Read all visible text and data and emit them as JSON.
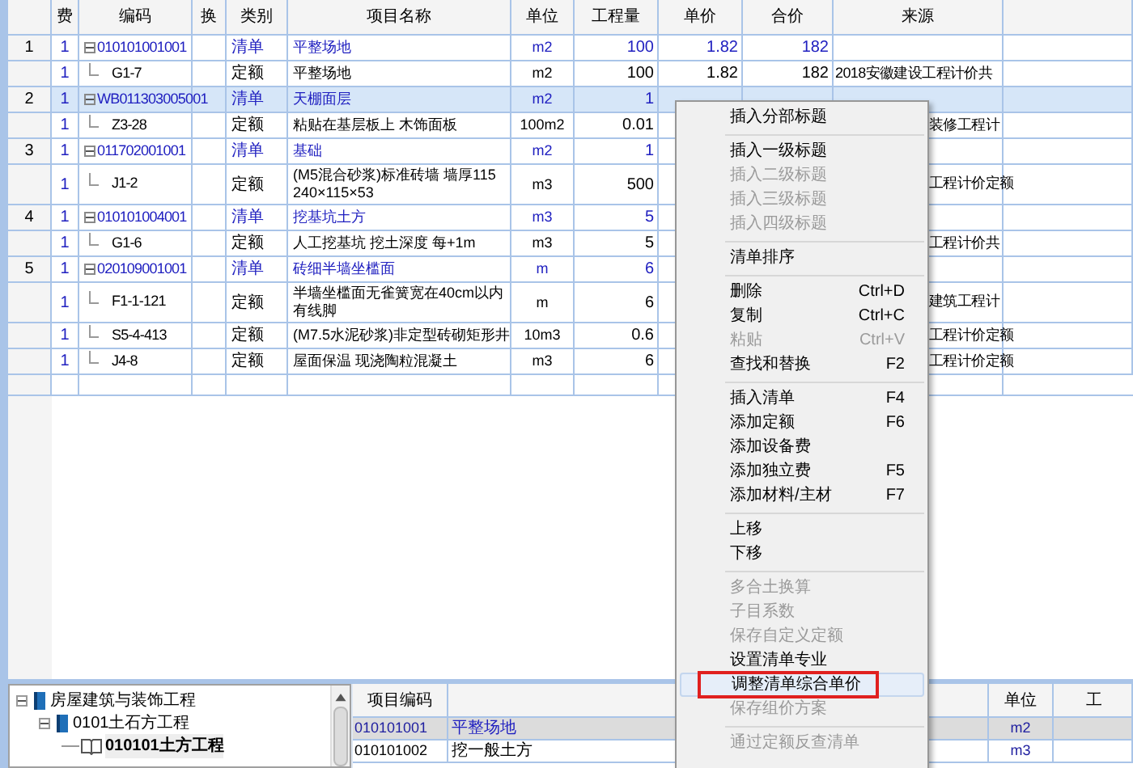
{
  "table": {
    "columns": [
      "费",
      "编码",
      "换",
      "类别",
      "项目名称",
      "单位",
      "工程量",
      "单价",
      "合价",
      "来源"
    ],
    "rows": [
      {
        "number": "1",
        "fee": "1",
        "code": "010101001001",
        "kind": "bill",
        "category": "清单",
        "name": "平整场地",
        "unit": "m2",
        "quantity": "100",
        "price": "1.82",
        "total": "182",
        "selected": false
      },
      {
        "fee": "1",
        "code": "G1-7",
        "kind": "norm",
        "category": "定额",
        "name": "平整场地",
        "unit": "m2",
        "quantity": "100",
        "price": "1.82",
        "total": "182",
        "source": "2018安徽建设工程计价共",
        "selected": false
      },
      {
        "number": "2",
        "fee": "1",
        "code": "WB011303005001",
        "kind": "bill",
        "category": "清单",
        "name": "天棚面层",
        "unit": "m2",
        "quantity": "1",
        "selected": true
      },
      {
        "fee": "1",
        "code": "Z3-28",
        "kind": "norm",
        "category": "定额",
        "name": "粘贴在基层板上 木饰面板",
        "unit": "100m2",
        "quantity": "0.01",
        "source": "装修工程计",
        "selected": false
      },
      {
        "number": "3",
        "fee": "1",
        "code": "011702001001",
        "kind": "bill",
        "category": "清单",
        "name": "基础",
        "unit": "m2",
        "quantity": "1",
        "selected": false
      },
      {
        "fee": "1",
        "code": "J1-2",
        "kind": "norm",
        "category": "定额",
        "name": "(M5混合砂浆)标准砖墙 墙厚115\n240×115×53",
        "unit": "m3",
        "quantity": "500",
        "source": "工程计价定额",
        "selected": false
      },
      {
        "number": "4",
        "fee": "1",
        "code": "010101004001",
        "kind": "bill",
        "category": "清单",
        "name": "挖基坑土方",
        "unit": "m3",
        "quantity": "5",
        "selected": false
      },
      {
        "fee": "1",
        "code": "G1-6",
        "kind": "norm",
        "category": "定额",
        "name": "人工挖基坑 挖土深度 每+1m",
        "unit": "m3",
        "quantity": "5",
        "source": "工程计价共",
        "selected": false
      },
      {
        "number": "5",
        "fee": "1",
        "code": "020109001001",
        "kind": "bill",
        "category": "清单",
        "name": "砖细半墙坐槛面",
        "unit": "m",
        "quantity": "6",
        "selected": false
      },
      {
        "fee": "1",
        "code": "F1-1-121",
        "kind": "norm",
        "category": "定额",
        "name": [
          "半墙坐槛面无雀簧宽在40cm以内",
          "有线脚"
        ],
        "unit": "m",
        "quantity": "6",
        "source": "建筑工程计",
        "selected": false
      },
      {
        "fee": "1",
        "code": "S5-4-413",
        "kind": "norm",
        "category": "定额",
        "name": "(M7.5水泥砂浆)非定型砖砌矩形井",
        "unit": "10m3",
        "quantity": "0.6",
        "source": "工程计价定额",
        "selected": false
      },
      {
        "fee": "1",
        "code": "J4-8",
        "kind": "norm",
        "category": "定额",
        "name": "屋面保温 现浇陶粒混凝土",
        "unit": "m3",
        "quantity": "6",
        "source": "工程计价定额",
        "selected": false
      }
    ]
  },
  "context_menu": [
    {
      "kind": "item",
      "label": "插入分部标题",
      "disabled": false,
      "selected": false
    },
    {
      "kind": "separator"
    },
    {
      "kind": "item",
      "label": "插入一级标题",
      "disabled": false,
      "selected": false
    },
    {
      "kind": "item",
      "label": "插入二级标题",
      "disabled": true,
      "selected": false
    },
    {
      "kind": "item",
      "label": "插入三级标题",
      "disabled": true,
      "selected": false
    },
    {
      "kind": "item",
      "label": "插入四级标题",
      "disabled": true,
      "selected": false
    },
    {
      "kind": "separator"
    },
    {
      "kind": "item",
      "label": "清单排序",
      "disabled": false,
      "selected": false
    },
    {
      "kind": "separator"
    },
    {
      "kind": "item",
      "label": "删除",
      "shortcut": "Ctrl+D",
      "disabled": false,
      "selected": false
    },
    {
      "kind": "item",
      "label": "复制",
      "shortcut": "Ctrl+C",
      "disabled": false,
      "selected": false
    },
    {
      "kind": "item",
      "label": "粘贴",
      "shortcut": "Ctrl+V",
      "disabled": true,
      "selected": false
    },
    {
      "kind": "item",
      "label": "查找和替换",
      "shortcut": "F2",
      "disabled": false,
      "selected": false
    },
    {
      "kind": "separator"
    },
    {
      "kind": "item",
      "label": "插入清单",
      "shortcut": "F4",
      "disabled": false,
      "selected": false
    },
    {
      "kind": "item",
      "label": "添加定额",
      "shortcut": "F6",
      "disabled": false,
      "selected": false
    },
    {
      "kind": "item",
      "label": "添加设备费",
      "disabled": false,
      "selected": false
    },
    {
      "kind": "item",
      "label": "添加独立费",
      "shortcut": "F5",
      "disabled": false,
      "selected": false
    },
    {
      "kind": "item",
      "label": "添加材料/主材",
      "shortcut": "F7",
      "disabled": false,
      "selected": false
    },
    {
      "kind": "separator"
    },
    {
      "kind": "item",
      "label": "上移",
      "disabled": false,
      "selected": false
    },
    {
      "kind": "item",
      "label": "下移",
      "disabled": false,
      "selected": false
    },
    {
      "kind": "separator"
    },
    {
      "kind": "item",
      "label": "多合土换算",
      "disabled": true,
      "selected": false
    },
    {
      "kind": "item",
      "label": "子目系数",
      "disabled": true,
      "selected": false
    },
    {
      "kind": "item",
      "label": "保存自定义定额",
      "disabled": true,
      "selected": false
    },
    {
      "kind": "item",
      "label": "设置清单专业",
      "disabled": false,
      "selected": false
    },
    {
      "kind": "item",
      "label": "调整清单综合单价",
      "disabled": false,
      "selected": true
    },
    {
      "kind": "item",
      "label": "保存组价方案",
      "disabled": true,
      "selected": false
    },
    {
      "kind": "separator"
    },
    {
      "kind": "item",
      "label": "通过定额反查清单",
      "disabled": true,
      "selected": false
    }
  ],
  "tree": [
    {
      "label": "房屋建筑与装饰工程",
      "expanded": true,
      "selected": false,
      "children": [
        {
          "label": "0101土石方工程",
          "expanded": true,
          "selected": false,
          "children": [
            {
              "label": "010101土方工程",
              "selected": true
            }
          ]
        }
      ]
    }
  ],
  "bill_list": {
    "columns": [
      "项目编码",
      "",
      "单位",
      "工"
    ],
    "rows": [
      {
        "code": "010101001",
        "name": "平整场地",
        "unit": "m2",
        "selected": true
      },
      {
        "code": "010101002",
        "name": "挖一般土方",
        "unit": "m3",
        "selected": false
      }
    ]
  }
}
